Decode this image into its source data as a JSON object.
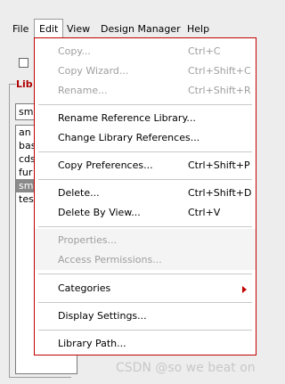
{
  "menubar": {
    "items": [
      {
        "label": "File"
      },
      {
        "label": "Edit"
      },
      {
        "label": "View"
      },
      {
        "label": "Design Manager"
      },
      {
        "label": "Help"
      }
    ]
  },
  "library_group": {
    "label": "Lib",
    "field_value": "sm",
    "list": [
      "an",
      "bas",
      "cds",
      "fur",
      "sm",
      "tes"
    ],
    "selected": "sm"
  },
  "edit_menu": {
    "items": [
      {
        "label": "Copy...",
        "shortcut": "Ctrl+C",
        "enabled": false
      },
      {
        "label": "Copy Wizard...",
        "shortcut": "Ctrl+Shift+C",
        "enabled": false
      },
      {
        "label": "Rename...",
        "shortcut": "Ctrl+Shift+R",
        "enabled": false
      },
      {
        "label": "Rename Reference Library...",
        "shortcut": "",
        "enabled": true
      },
      {
        "label": "Change Library References...",
        "shortcut": "",
        "enabled": true
      },
      {
        "label": "Copy Preferences...",
        "shortcut": "Ctrl+Shift+P",
        "enabled": true
      },
      {
        "label": "Delete...",
        "shortcut": "Ctrl+Shift+D",
        "enabled": true
      },
      {
        "label": "Delete By View...",
        "shortcut": "Ctrl+V",
        "enabled": true
      },
      {
        "label": "Properties...",
        "shortcut": "",
        "enabled": false
      },
      {
        "label": "Access Permissions...",
        "shortcut": "",
        "enabled": false
      },
      {
        "label": "Categories",
        "shortcut": "",
        "enabled": true,
        "submenu": true
      },
      {
        "label": "Display Settings...",
        "shortcut": "",
        "enabled": true
      },
      {
        "label": "Library Path...",
        "shortcut": "",
        "enabled": true
      }
    ]
  },
  "watermark": "CSDN @so we beat on",
  "colors": {
    "accent": "#c00000",
    "disabled_text": "#9e9e9e",
    "selection": "#8a8a8a"
  }
}
